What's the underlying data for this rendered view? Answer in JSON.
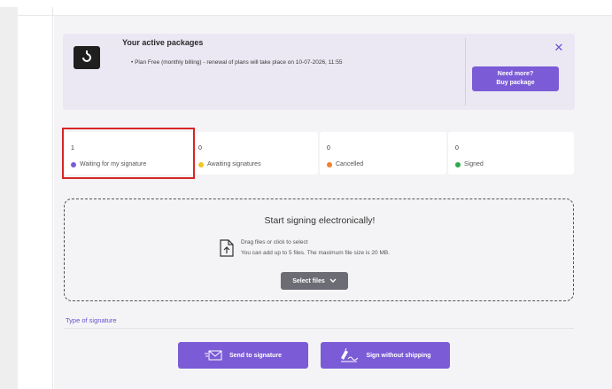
{
  "banner": {
    "title": "Your active packages",
    "bullet": "•  Plan Free (monthly billing) - renewal of plans will take place on 10-07-2026, 11:55",
    "buy_line1": "Need more?",
    "buy_line2": "Buy package"
  },
  "status_cards": [
    {
      "count": "1",
      "label": "Waiting for my signature",
      "color": "#7b5bd6"
    },
    {
      "count": "0",
      "label": "Awaiting signatures",
      "color": "#f2c51f"
    },
    {
      "count": "0",
      "label": "Cancelled",
      "color": "#f2802d"
    },
    {
      "count": "0",
      "label": "Signed",
      "color": "#2fa84f"
    }
  ],
  "dropzone": {
    "title": "Start signing electronically!",
    "line1": "Drag files or click to select",
    "line2": "You can add up to 5 files. The maximum file size is 20 MB.",
    "select_label": "Select files"
  },
  "signature": {
    "type_label": "Type of signature",
    "send_label": "Send to signature",
    "sign_label": "Sign without shipping"
  },
  "colors": {
    "accent": "#7b5bd6",
    "highlight": "#d62626"
  }
}
